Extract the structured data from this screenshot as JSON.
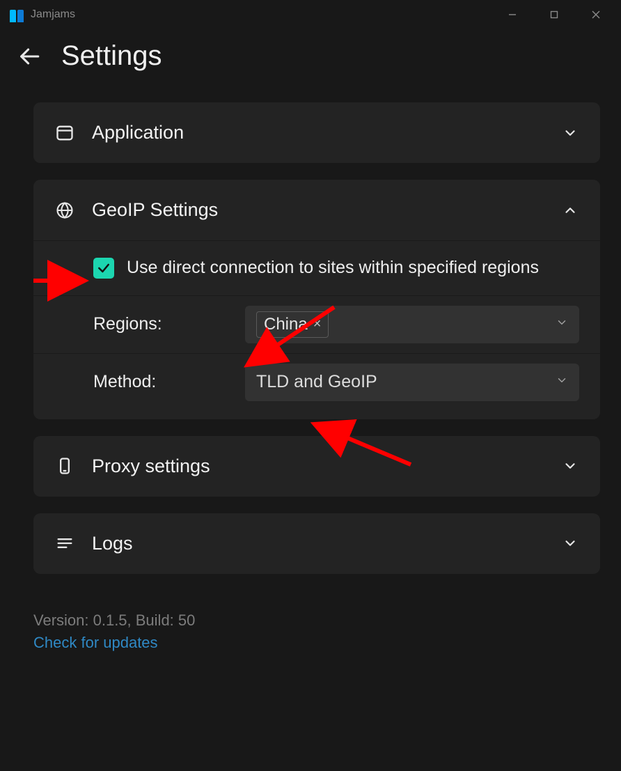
{
  "app": {
    "name": "Jamjams"
  },
  "page": {
    "title": "Settings"
  },
  "sections": {
    "application": {
      "title": "Application"
    },
    "geoip": {
      "title": "GeoIP Settings",
      "checkbox_label": "Use direct connection to sites within specified regions",
      "checkbox_checked": true,
      "regions_label": "Regions:",
      "regions_chip": "China",
      "method_label": "Method:",
      "method_value": "TLD and GeoIP"
    },
    "proxy": {
      "title": "Proxy settings"
    },
    "logs": {
      "title": "Logs"
    }
  },
  "footer": {
    "version_line": "Version: 0.1.5, Build: 50",
    "update_link": "Check for updates"
  },
  "annotation_color": "#ff0000"
}
